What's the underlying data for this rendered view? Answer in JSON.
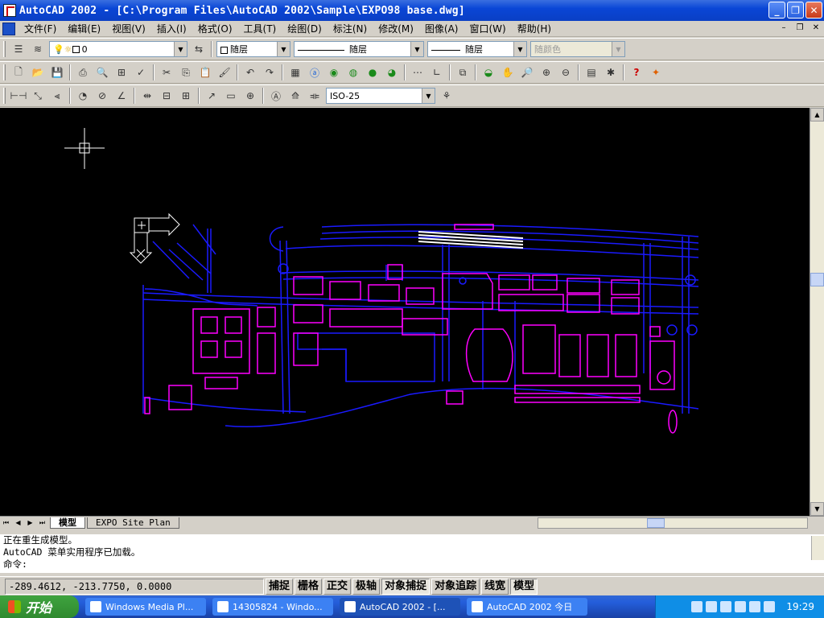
{
  "window": {
    "title": "AutoCAD 2002 - [C:\\Program Files\\AutoCAD 2002\\Sample\\EXPO98 base.dwg]"
  },
  "menu": {
    "items": [
      "文件(F)",
      "编辑(E)",
      "视图(V)",
      "插入(I)",
      "格式(O)",
      "工具(T)",
      "绘图(D)",
      "标注(N)",
      "修改(M)",
      "图像(A)",
      "窗口(W)",
      "帮助(H)"
    ]
  },
  "properties_toolbar": {
    "layer": "0",
    "color": "随层",
    "linetype": "随层",
    "lineweight": "随层",
    "plotstyle": "随颜色"
  },
  "dim_toolbar": {
    "dimstyle": "ISO-25"
  },
  "layout_tabs": {
    "model": "模型",
    "layout1": "EXPO Site Plan"
  },
  "command": {
    "history": [
      "正在重生成模型。",
      "AutoCAD 菜单实用程序已加载。"
    ],
    "prompt": "命令:"
  },
  "status": {
    "coords": "-289.4612, -213.7750, 0.0000",
    "toggles": [
      {
        "label": "捕捉",
        "on": false
      },
      {
        "label": "栅格",
        "on": false
      },
      {
        "label": "正交",
        "on": false
      },
      {
        "label": "极轴",
        "on": false
      },
      {
        "label": "对象捕捉",
        "on": true
      },
      {
        "label": "对象追踪",
        "on": false
      },
      {
        "label": "线宽",
        "on": false
      },
      {
        "label": "模型",
        "on": true
      }
    ]
  },
  "taskbar": {
    "start_label": "开始",
    "tasks": [
      "Windows Media Pl...",
      "14305824 - Windo...",
      "AutoCAD 2002 - [...",
      "AutoCAD 2002 今日"
    ],
    "clock": "19:29"
  },
  "colors": {
    "drawing_bg": "#000000",
    "cad_blue": "#1a1aff",
    "cad_magenta": "#ff00ff",
    "cad_white": "#ffffff"
  }
}
